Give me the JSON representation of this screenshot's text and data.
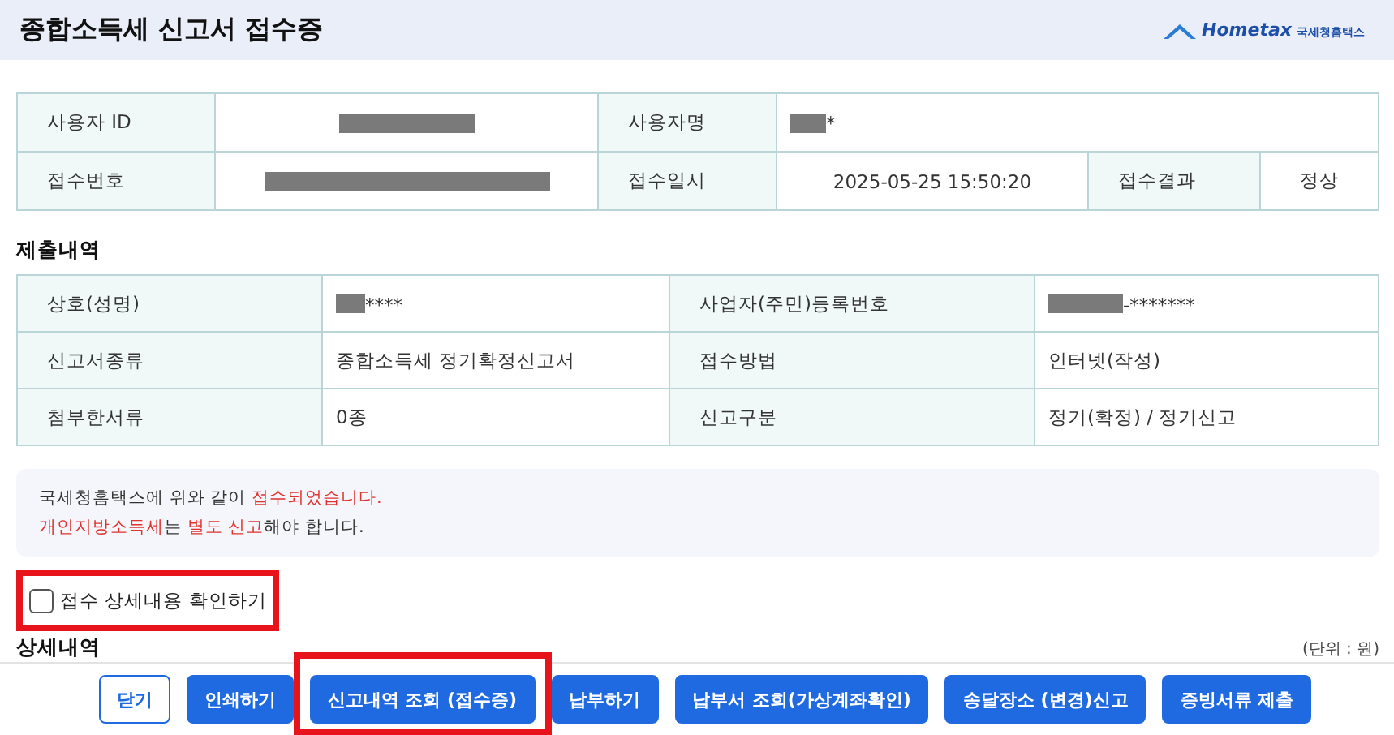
{
  "header": {
    "title": "종합소득세 신고서 접수증",
    "logo": {
      "name": "Hometax",
      "subtitle": "국세청홈택스"
    }
  },
  "user_table": {
    "rows": [
      [
        {
          "kind": "label",
          "text": "사용자 ID"
        },
        {
          "kind": "value",
          "redacted": true,
          "text": ""
        },
        {
          "kind": "label",
          "text": "사용자명"
        },
        {
          "kind": "value",
          "redacted": true,
          "text": "*"
        }
      ]
    ]
  },
  "receipt_table": {
    "rows": [
      [
        {
          "kind": "label",
          "text": "접수번호"
        },
        {
          "kind": "value",
          "redacted": true,
          "text": ""
        },
        {
          "kind": "label",
          "text": "접수일시"
        },
        {
          "kind": "value",
          "redacted": false,
          "text": "2025-05-25 15:50:20"
        },
        {
          "kind": "label",
          "text": "접수결과"
        },
        {
          "kind": "value",
          "redacted": false,
          "text": "정상"
        }
      ]
    ]
  },
  "submission": {
    "title": "제출내역",
    "rows": [
      [
        {
          "kind": "label",
          "text": "상호(성명)"
        },
        {
          "kind": "value",
          "redacted": true,
          "text": "****"
        },
        {
          "kind": "label",
          "text": "사업자(주민)등록번호"
        },
        {
          "kind": "value",
          "redacted": true,
          "text": "-*******"
        }
      ],
      [
        {
          "kind": "label",
          "text": "신고서종류"
        },
        {
          "kind": "value",
          "redacted": false,
          "text": "종합소득세 정기확정신고서"
        },
        {
          "kind": "label",
          "text": "접수방법"
        },
        {
          "kind": "value",
          "redacted": false,
          "text": "인터넷(작성)"
        }
      ],
      [
        {
          "kind": "label",
          "text": "첨부한서류"
        },
        {
          "kind": "value",
          "redacted": false,
          "text": "0종"
        },
        {
          "kind": "label",
          "text": "신고구분"
        },
        {
          "kind": "value",
          "redacted": false,
          "text": "정기(확정) / 정기신고"
        }
      ]
    ]
  },
  "notice": {
    "lines": [
      [
        {
          "text": "국세청홈택스에 위와 같이 ",
          "emphasis": false
        },
        {
          "text": "접수되었습니다.",
          "emphasis": true
        }
      ],
      [
        {
          "text": "개인지방소득세",
          "emphasis": true
        },
        {
          "text": "는 ",
          "emphasis": false
        },
        {
          "text": "별도 신고",
          "emphasis": true
        },
        {
          "text": "해야 합니다.",
          "emphasis": false
        }
      ]
    ]
  },
  "detail_checkbox": {
    "label": "접수 상세내용 확인하기",
    "checked": false,
    "highlighted": true
  },
  "details": {
    "title": "상세내역",
    "unit": "(단위 : 원)"
  },
  "buttons": [
    {
      "label": "닫기",
      "kind": "outline",
      "highlighted": false
    },
    {
      "label": "인쇄하기",
      "kind": "primary",
      "highlighted": false
    },
    {
      "label": "신고내역 조회 (접수증)",
      "kind": "primary",
      "highlighted": true
    },
    {
      "label": "납부하기",
      "kind": "primary",
      "highlighted": false
    },
    {
      "label": "납부서 조회(가상계좌확인)",
      "kind": "primary",
      "highlighted": false
    },
    {
      "label": "송달장소 (변경)신고",
      "kind": "primary",
      "highlighted": false
    },
    {
      "label": "증빙서류 제출",
      "kind": "primary",
      "highlighted": false
    }
  ]
}
